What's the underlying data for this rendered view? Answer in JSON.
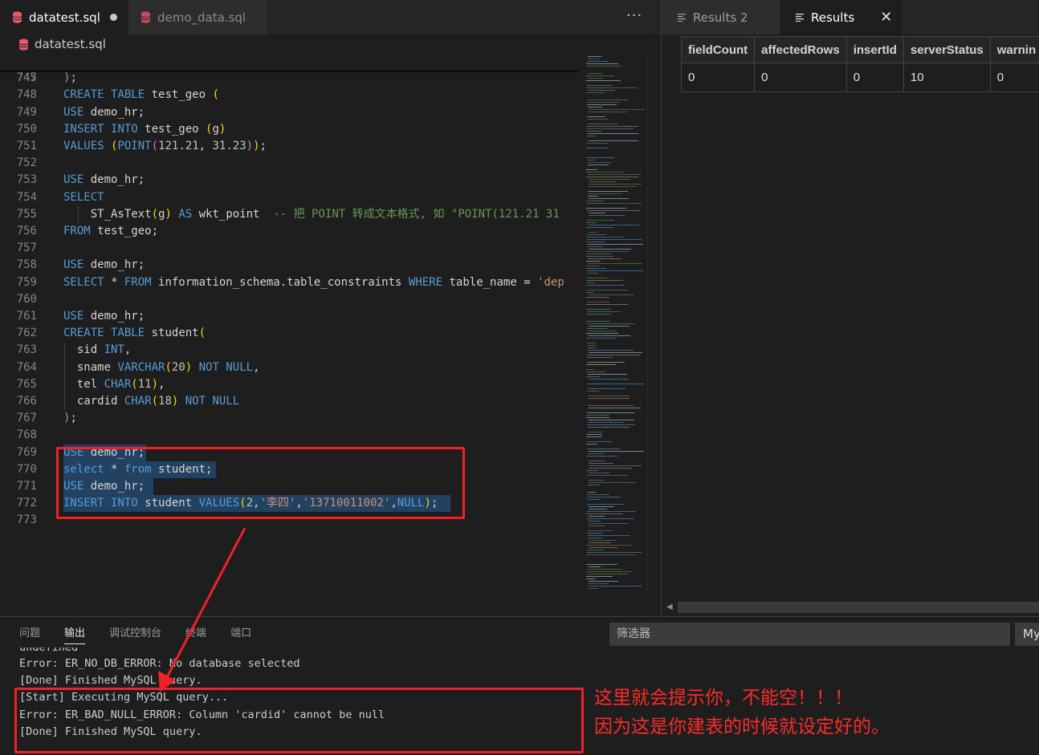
{
  "editor": {
    "tabs": [
      {
        "label": "datatest.sql",
        "dirty": true,
        "active": true
      },
      {
        "label": "demo_data.sql",
        "dirty": false,
        "active": false
      }
    ],
    "more_label": "···",
    "breadcrumb": "datatest.sql",
    "sticky_line": {
      "num": "745",
      "text": "CREATE TABLE test_geo ("
    },
    "lines": [
      {
        "num": "747",
        "text": ");"
      },
      {
        "num": "748",
        "text": ""
      },
      {
        "num": "749",
        "text": "USE demo_hr;"
      },
      {
        "num": "750",
        "text": "INSERT INTO test_geo (g)"
      },
      {
        "num": "751",
        "text": "VALUES (POINT(121.21, 31.23));"
      },
      {
        "num": "752",
        "text": ""
      },
      {
        "num": "753",
        "text": "USE demo_hr;"
      },
      {
        "num": "754",
        "text": "SELECT"
      },
      {
        "num": "755",
        "text": "    ST_AsText(g) AS wkt_point  -- 把 POINT 转成文本格式, 如 \"POINT(121.21 31"
      },
      {
        "num": "756",
        "text": "FROM test_geo;"
      },
      {
        "num": "757",
        "text": ""
      },
      {
        "num": "758",
        "text": "USE demo_hr;"
      },
      {
        "num": "759",
        "text": "SELECT * FROM information_schema.table_constraints WHERE table_name = 'dep"
      },
      {
        "num": "760",
        "text": ""
      },
      {
        "num": "761",
        "text": "USE demo_hr;"
      },
      {
        "num": "762",
        "text": "CREATE TABLE student("
      },
      {
        "num": "763",
        "text": "  sid INT,"
      },
      {
        "num": "764",
        "text": "  sname VARCHAR(20) NOT NULL,"
      },
      {
        "num": "765",
        "text": "  tel CHAR(11),"
      },
      {
        "num": "766",
        "text": "  cardid CHAR(18) NOT NULL"
      },
      {
        "num": "767",
        "text": ");"
      },
      {
        "num": "768",
        "text": ""
      },
      {
        "num": "769",
        "text": "USE demo_hr;"
      },
      {
        "num": "770",
        "text": "select * from student;"
      },
      {
        "num": "771",
        "text": "USE demo_hr;"
      },
      {
        "num": "772",
        "text": "INSERT INTO student VALUES(2,'李四','13710011002',NULL);"
      },
      {
        "num": "773",
        "text": ""
      }
    ]
  },
  "results": {
    "tabs": [
      {
        "label": "Results 2",
        "active": false
      },
      {
        "label": "Results",
        "active": true
      }
    ],
    "close_label": "✕",
    "columns": [
      "fieldCount",
      "affectedRows",
      "insertId",
      "serverStatus",
      "warnin"
    ],
    "rows": [
      [
        "0",
        "0",
        "0",
        "10",
        "0"
      ]
    ]
  },
  "bottom": {
    "tabs": [
      {
        "label": "问题",
        "active": false
      },
      {
        "label": "输出",
        "active": true
      },
      {
        "label": "调试控制台",
        "active": false
      },
      {
        "label": "终端",
        "active": false
      },
      {
        "label": "端口",
        "active": false
      }
    ],
    "filter_placeholder": "筛选器",
    "channel_label": "My",
    "output": [
      "undefined",
      "Error: ER_NO_DB_ERROR: No database selected",
      "[Done] Finished MySQL query.",
      "[Start] Executing MySQL query...",
      "Error: ER_BAD_NULL_ERROR: Column 'cardid' cannot be null",
      "[Done] Finished MySQL query."
    ]
  },
  "annotation": {
    "line1": "这里就会提示你，不能空！！！",
    "line2": "因为这是你建表的时候就设定好的。",
    "color": "#f0202a"
  },
  "colors": {
    "keyword": "#569cd6",
    "string": "#ce9178",
    "number": "#b5cea8",
    "comment": "#6a9955",
    "background": "#1e1e1e"
  }
}
